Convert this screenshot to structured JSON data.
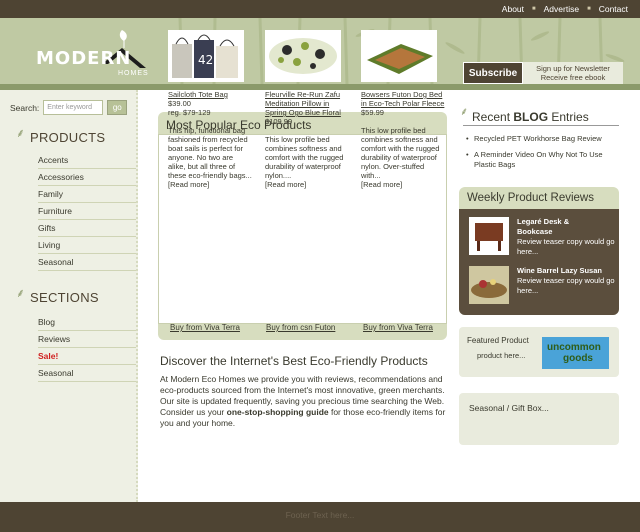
{
  "top_nav": {
    "about": "About",
    "advertise": "Advertise",
    "contact": "Contact",
    "separator": "■"
  },
  "header": {
    "logo": "MODERN",
    "logo_sub": "HOMES",
    "subscribe_label": "Subscribe",
    "subscribe_text_1": "Sign up for Newsletter",
    "subscribe_text_2": "Receive free ebook"
  },
  "search": {
    "label": "Search:",
    "placeholder": "Enter keyword",
    "go_label": "go"
  },
  "products_nav": {
    "title": "PRODUCTS",
    "items": [
      "Accents",
      "Accessories",
      "Family",
      "Furniture",
      "Gifts",
      "Living",
      "Seasonal"
    ]
  },
  "sections_nav": {
    "title": "SECTIONS",
    "items": [
      "Blog",
      "Reviews",
      "Sale!",
      "Seasonal"
    ]
  },
  "popular": {
    "title": "Most Popular Eco Products",
    "products": [
      {
        "name": "Sailcloth Tote Bag",
        "price": "$39.00",
        "range": "reg. $79-129",
        "desc": "This hip, functional bag fashioned from recycled boat sails is perfect for anyone. No two are alike, but all three of these eco-friendly bags...",
        "more": "[Read more]",
        "buy": "Buy from Viva Terra"
      },
      {
        "name": "Fleurville Re-Run Zafu Meditation Pillow in Spring Ogo Blue Floral",
        "price": "$109.99",
        "range": "",
        "desc": "This low profile bed combines softness and comfort with the rugged durability of waterproof nylon....",
        "more": "[Read more]",
        "buy": "Buy from csn Futon"
      },
      {
        "name": "Bowsers Futon Dog Bed in Eco-Tech Polar Fleece",
        "price": "$59.99",
        "range": "",
        "desc": "This low profile bed combines softness and comfort with the rugged durability of waterproof nylon. Over-stuffed with...",
        "more": "[Read more]",
        "buy": "Buy from Viva Terra"
      }
    ]
  },
  "discover": {
    "title": "Discover the Internet's Best Eco-Friendly Products",
    "text_1": "At Modern Eco Homes we provide you with reviews, recommendations and eco-products sourced from the Internet's most innovative, green merchants. Our site is updated frequently, saving you precious time searching the Web. Consider us your ",
    "bold": "one-stop-shopping guide",
    "text_2": " for those eco-friendly items for you and your home."
  },
  "blog": {
    "title_prefix": "Recent ",
    "title_bold": "BLOG",
    "title_suffix": " Entries",
    "entries": [
      "Recycled PET Workhorse Bag Review",
      "A Reminder Video On Why Not To Use Plastic Bags"
    ]
  },
  "weekly": {
    "title": "Weekly Product Reviews",
    "reviews": [
      {
        "title_1": "Legaré Desk &",
        "title_2": "Bookcase",
        "text": "Review teaser copy would go here..."
      },
      {
        "title_1": "Wine Barrel Lazy Susan",
        "title_2": "",
        "text": "Review teaser copy would go here..."
      }
    ]
  },
  "featured": {
    "label": "Featured Product",
    "sub": "product here...",
    "logo_1": "uncommon",
    "logo_2": "goods"
  },
  "seasonal_box": {
    "label": "Seasonal / Gift Box..."
  },
  "footer": {
    "text": "Footer Text here..."
  }
}
